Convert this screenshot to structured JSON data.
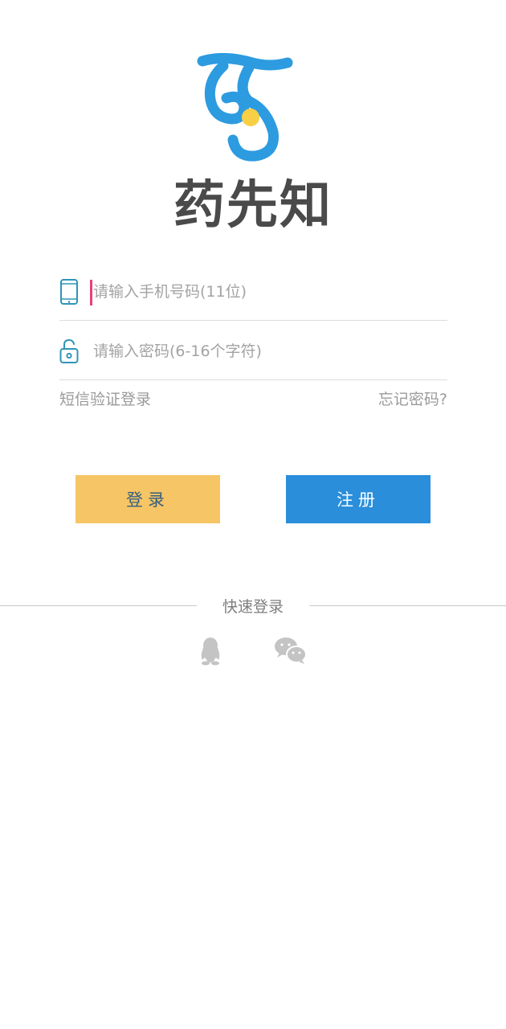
{
  "app": {
    "name": "药先知",
    "logo_icon": "app-logo-icon",
    "colors": {
      "logo_blue": "#2d9be0",
      "logo_dot": "#f8cf45",
      "login_button": "#f6c566",
      "register_button": "#2a8edb",
      "field_icon": "#2f95b8",
      "caret": "#e8407a"
    }
  },
  "form": {
    "phone": {
      "icon": "phone-icon",
      "placeholder": "请输入手机号码(11位)",
      "value": ""
    },
    "password": {
      "icon": "unlock-icon",
      "placeholder": "请输入密码(6-16个字符)",
      "value": ""
    },
    "sms_login_label": "短信验证登录",
    "forgot_password_label": "忘记密码?"
  },
  "buttons": {
    "login_label": "登录",
    "register_label": "注册"
  },
  "quick_login": {
    "label": "快速登录",
    "providers": [
      {
        "name": "qq",
        "icon": "qq-icon"
      },
      {
        "name": "wechat",
        "icon": "wechat-icon"
      }
    ]
  }
}
